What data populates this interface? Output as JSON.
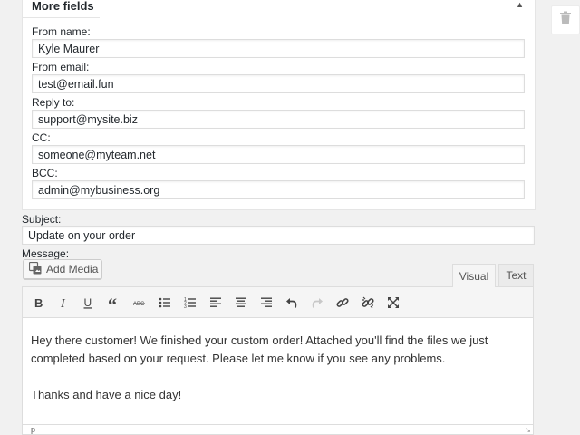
{
  "panel": {
    "title": "More fields",
    "fields": [
      {
        "label": "From name:",
        "value": "Kyle Maurer"
      },
      {
        "label": "From email:",
        "value": "test@email.fun"
      },
      {
        "label": "Reply to:",
        "value": "support@mysite.biz"
      },
      {
        "label": "CC:",
        "value": "someone@myteam.net"
      },
      {
        "label": "BCC:",
        "value": "admin@mybusiness.org"
      }
    ]
  },
  "subject": {
    "label": "Subject:",
    "value": "Update on your order"
  },
  "message": {
    "label": "Message:",
    "add_media_label": "Add Media",
    "tabs": [
      {
        "label": "Visual",
        "active": true
      },
      {
        "label": "Text",
        "active": false
      }
    ],
    "toolbar_icons": [
      "bold-icon",
      "italic-icon",
      "underline-icon",
      "blockquote-icon",
      "strikethrough-icon",
      "bulleted-list-icon",
      "numbered-list-icon",
      "align-left-icon",
      "align-center-icon",
      "align-right-icon",
      "undo-icon",
      "redo-icon",
      "link-icon",
      "unlink-icon",
      "fullscreen-icon"
    ],
    "body": [
      "Hey there customer! We finished your custom order! Attached you'll find the files we just completed based on your request. Please let me know if you see any problems.",
      "Thanks and have a nice day!"
    ],
    "status_path": "p"
  },
  "colors": {
    "accent": "#23282d",
    "border": "#dddddd",
    "background": "#f1f1f1"
  }
}
